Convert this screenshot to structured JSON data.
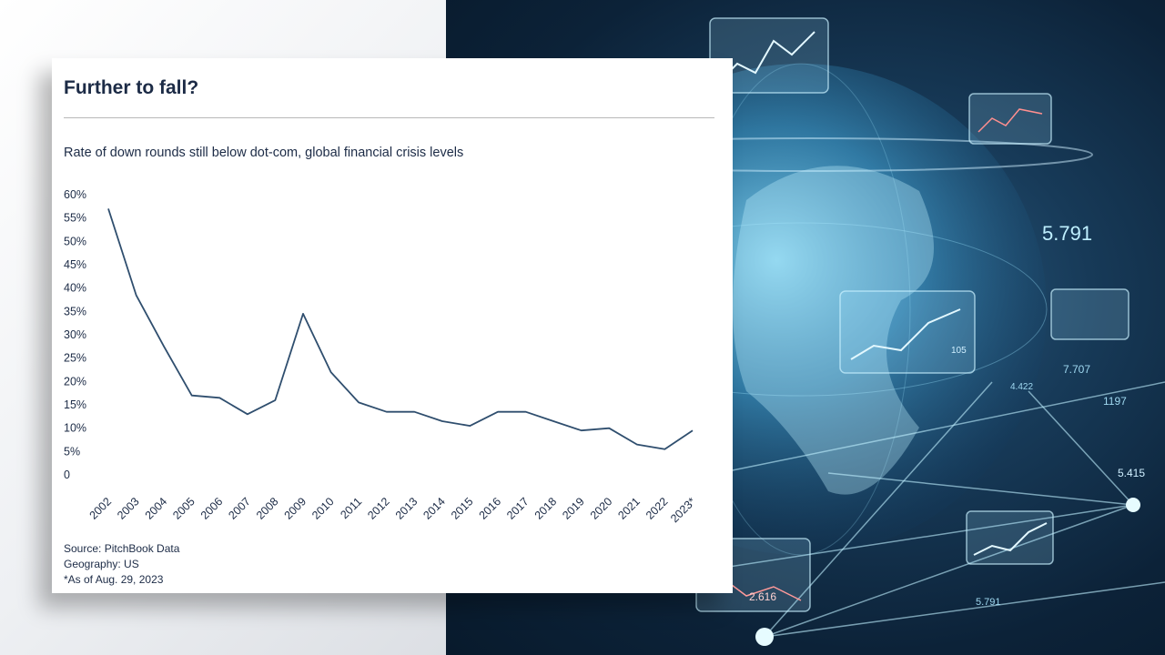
{
  "card": {
    "title": "Further to fall?",
    "subtitle": "Rate of down rounds still below dot-com, global financial crisis levels",
    "source": "Source: PitchBook Data",
    "geography": "Geography: US",
    "footnote": "*As of Aug. 29, 2023"
  },
  "background": {
    "readout_large": "5.791",
    "readout_small": [
      "7.707",
      "5.415",
      "1197",
      "4.422",
      "5.791",
      "2.616",
      "105"
    ],
    "theme_color": "#5fd0ff"
  },
  "chart_data": {
    "type": "line",
    "title": "Rate of down rounds still below dot-com, global financial crisis levels",
    "x": [
      "2002",
      "2003",
      "2004",
      "2005",
      "2006",
      "2007",
      "2008",
      "2009",
      "2010",
      "2011",
      "2012",
      "2013",
      "2014",
      "2015",
      "2016",
      "2017",
      "2018",
      "2019",
      "2020",
      "2021",
      "2022",
      "2023*"
    ],
    "series": [
      {
        "values": [
          57,
          38.5,
          27.5,
          17,
          16.5,
          13,
          16,
          34.5,
          22,
          15.5,
          13.5,
          13.5,
          11.5,
          10.5,
          13.5,
          13.5,
          11.5,
          9.5,
          10,
          6.5,
          5.5,
          9.5
        ]
      }
    ],
    "yticks": [
      "0",
      "5%",
      "10%",
      "15%",
      "20%",
      "25%",
      "30%",
      "35%",
      "40%",
      "45%",
      "50%",
      "55%",
      "60%"
    ],
    "ylim": [
      0,
      60
    ],
    "xlabel": "",
    "ylabel": "",
    "grid": false,
    "line_color": "#2f4e6e"
  }
}
